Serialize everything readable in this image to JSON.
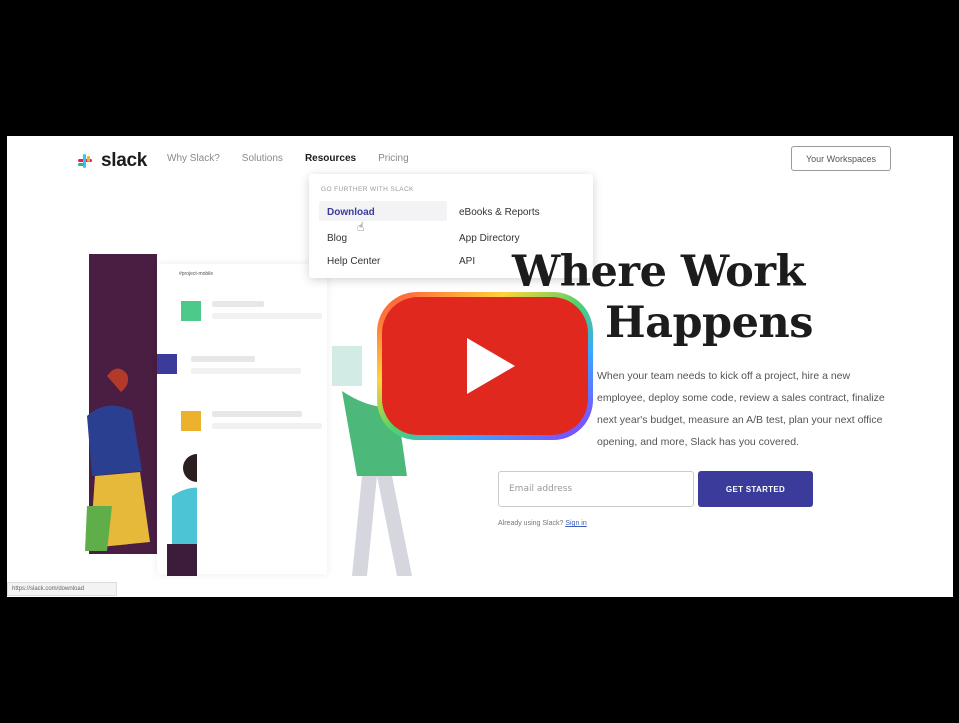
{
  "nav": {
    "logo_text": "slack",
    "items": [
      {
        "label": "Why Slack?"
      },
      {
        "label": "Solutions"
      },
      {
        "label": "Resources"
      },
      {
        "label": "Pricing"
      }
    ],
    "workspace_button": "Your Workspaces"
  },
  "dropdown": {
    "heading": "GO FURTHER WITH SLACK",
    "items": [
      "Download",
      "Blog",
      "Help Center",
      "eBooks & Reports",
      "App Directory",
      "API"
    ]
  },
  "hero": {
    "title_line1": "Where Work",
    "title_line2": "Happens",
    "body_line1": "When your team needs to kick off a project, hire a new",
    "body_line2": "employee, deploy some code, review a sales contract, finalize",
    "body_line3": "next year's budget, measure an A/B test, plan your next office",
    "body_line4": "opening, and more, Slack has you covered.",
    "email_placeholder": "Email address",
    "cta_label": "GET STARTED",
    "signin_prefix": "Already using Slack?",
    "signin_link": "Sign in"
  },
  "illustration": {
    "card_title": "#project-mobile"
  },
  "status_bar_url": "https://slack.com/download",
  "colors": {
    "accent": "#3b3b9b",
    "aubergine": "#4a1d42",
    "yt_red": "#e0281f"
  },
  "icons": [
    "slack-logo-icon",
    "cursor-icon",
    "youtube-play-icon"
  ]
}
